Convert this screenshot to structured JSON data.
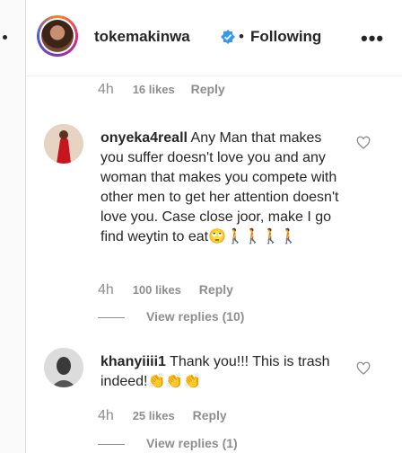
{
  "header": {
    "username": "tokemakinwa",
    "separator": "•",
    "follow_status": "Following",
    "more_label": "•••"
  },
  "prev_comment": {
    "age": "4h",
    "likes": "16 likes",
    "reply": "Reply"
  },
  "comments": [
    {
      "username": "onyeka4reall",
      "text": "Any Man that makes you suffer doesn't love you and any woman that makes you compete with other men to get her attention doesn't love you. Case close joor, make I go find weytin to eat",
      "emoji": "🙄🚶🚶🚶🚶",
      "age": "4h",
      "likes": "100 likes",
      "reply": "Reply",
      "view_replies": "View replies (10)"
    },
    {
      "username": "khanyiiii1",
      "text": "Thank you!!! This is trash indeed!",
      "emoji": "👏👏👏",
      "age": "4h",
      "likes": "25 likes",
      "reply": "Reply",
      "view_replies": "View replies (1)"
    }
  ],
  "colors": {
    "muted": "#8e8e8e",
    "text": "#262626",
    "verified": "#3897f0"
  },
  "icons": [
    "verified-badge-icon",
    "heart-icon",
    "more-options-icon"
  ]
}
